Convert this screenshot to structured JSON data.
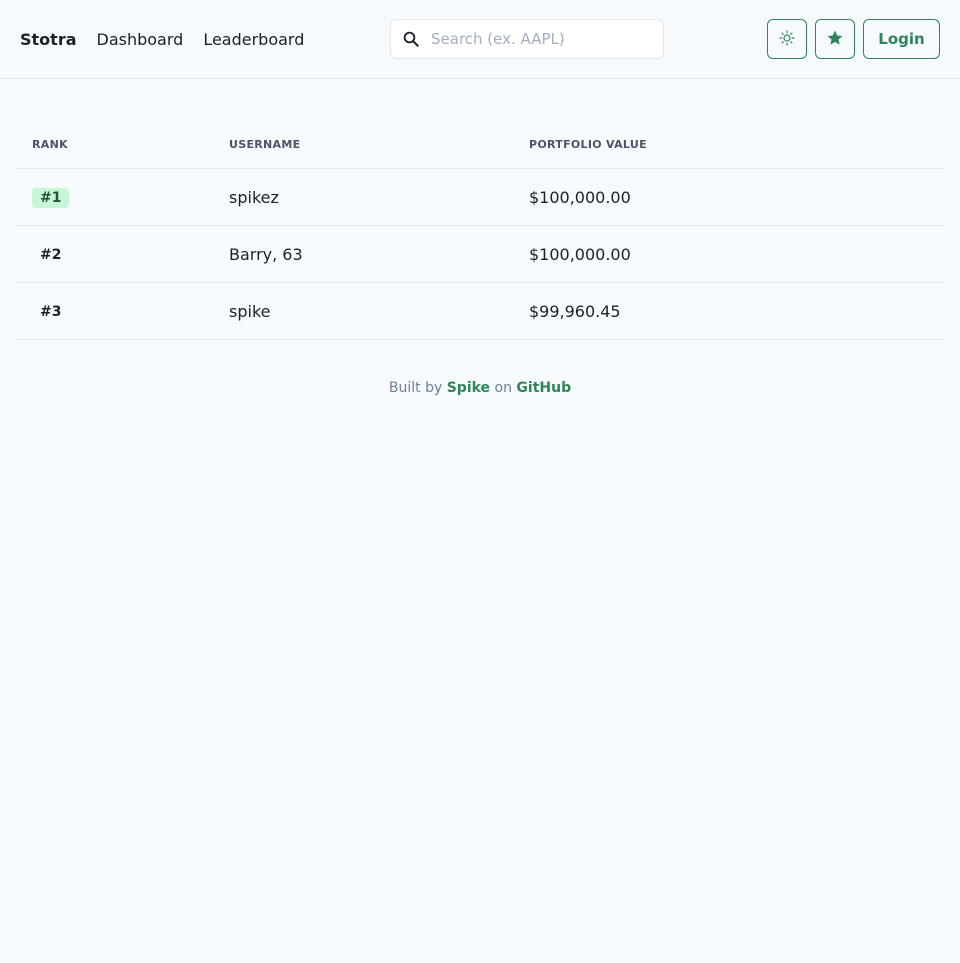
{
  "nav": {
    "brand": "Stotra",
    "links": [
      "Dashboard",
      "Leaderboard"
    ],
    "search_placeholder": "Search (ex. AAPL)",
    "login_label": "Login"
  },
  "icons": {
    "search": "search-icon",
    "theme": "sun-icon",
    "star": "star-icon"
  },
  "colors": {
    "accent": "#2f855a",
    "badge_bg": "#c6f6d5",
    "badge_text": "#22543d"
  },
  "table": {
    "headers": [
      "RANK",
      "USERNAME",
      "PORTFOLIO VALUE"
    ],
    "rows": [
      {
        "rank": "#1",
        "username": "spikez",
        "value": "$100,000.00"
      },
      {
        "rank": "#2",
        "username": "Barry, 63",
        "value": "$100,000.00"
      },
      {
        "rank": "#3",
        "username": "spike",
        "value": "$99,960.45"
      }
    ]
  },
  "footer": {
    "prefix": "Built by",
    "author": "Spike",
    "middle": "on",
    "site": "GitHub"
  }
}
